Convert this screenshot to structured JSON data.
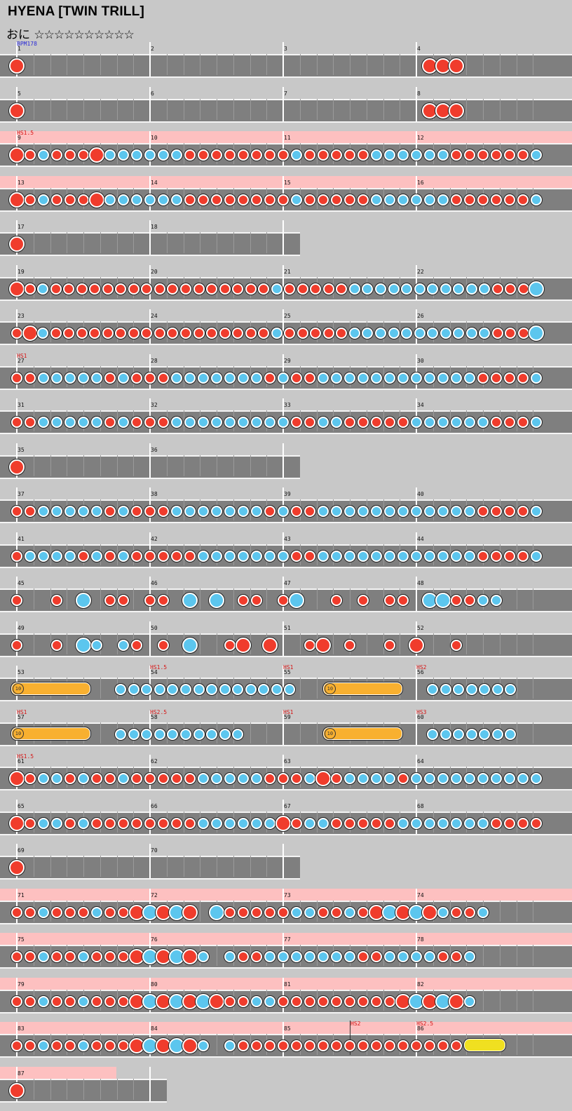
{
  "title": "HYENA [TWIN TRILL]",
  "difficulty": "おに",
  "stars": "☆☆☆☆☆☆☆☆☆☆",
  "colors": {
    "background": "#c8c8c8",
    "track": "#7f7f7f",
    "don": "#f03c2c",
    "ka": "#5cc6ee",
    "scroll_band": "#fdc0c0",
    "roll": "#f8b030",
    "balloon": "#f0e020"
  },
  "rows": [
    {
      "measures": [
        "1",
        "2",
        "3",
        "4"
      ],
      "labels": [
        {
          "text": "BPM178",
          "type": "bpm"
        }
      ],
      "band": false,
      "notes": "D..............................DDD......"
    },
    {
      "measures": [
        "5",
        "6",
        "7",
        "8"
      ],
      "labels": [],
      "band": false,
      "notes": "D..............................DDD......"
    },
    {
      "measures": [
        "9",
        "10",
        "11",
        "12"
      ],
      "labels": [
        {
          "text": "HS1.5",
          "type": "hs"
        }
      ],
      "band": true,
      "notes": "DdkdddDkkkkkkddddddddkdddddkkkkkkddddddk"
    },
    {
      "measures": [
        "13",
        "14",
        "15",
        "16"
      ],
      "labels": [],
      "band": true,
      "notes": "DdkdddDkkkkkkddddddddkdddddkkkkkkddddddk"
    },
    {
      "measures": [
        "17",
        "18"
      ],
      "labels": [],
      "band": false,
      "short": true,
      "notes": "D..................."
    },
    {
      "measures": [
        "19",
        "20",
        "21",
        "22"
      ],
      "labels": [],
      "band": false,
      "notes": "DdkdddddddddddddddddkdddddkkkkkkkkkkkdddK"
    },
    {
      "measures": [
        "23",
        "24",
        "25",
        "26"
      ],
      "labels": [],
      "band": false,
      "notes": "dDkdddddddddddddddddkdddddkkkkkkkkkkkdddK"
    },
    {
      "measures": [
        "27",
        "28",
        "29",
        "30"
      ],
      "labels": [
        {
          "text": "HS1",
          "type": "hs"
        }
      ],
      "band": false,
      "notes": "ddkkkkkdkdddkkkkkkkdkddkkkkkkkkkkkkddddk"
    },
    {
      "measures": [
        "31",
        "32",
        "33",
        "34"
      ],
      "labels": [],
      "band": false,
      "notes": "ddkkkkkdkdddkkkkkkkkkddkkdddddkkkkkkdddk"
    },
    {
      "measures": [
        "35",
        "36"
      ],
      "labels": [],
      "band": false,
      "short": true,
      "notes": "D..................."
    },
    {
      "measures": [
        "37",
        "38",
        "39",
        "40"
      ],
      "labels": [],
      "band": false,
      "notes": "ddkkkkkdkdddkkkkkkkdkddkkkkkkkkkkkkddddk"
    },
    {
      "measures": [
        "41",
        "42",
        "43",
        "44"
      ],
      "labels": [],
      "band": false,
      "notes": "dkkkkdkdkdddddkkkkkkkddkkkkkkkkkkkkddddk"
    },
    {
      "measures": [
        "45",
        "46",
        "47",
        "48"
      ],
      "labels": [],
      "band": false,
      "notes": "d..d.K.dd.dd.K.K.dd.dK..d.d.dd.KKddkk..."
    },
    {
      "measures": [
        "49",
        "50",
        "51",
        "52"
      ],
      "labels": [],
      "band": false,
      "notes": "d..d.Kk.kd.d.K..dD.D..dD.d..d.D..d......"
    },
    {
      "measures": [
        "53",
        "54",
        "55",
        "56"
      ],
      "labels": [
        {
          "text": "HS1.5",
          "type": "hs"
        },
        {
          "text": "HS1",
          "type": "hs"
        },
        {
          "text": "HS2",
          "type": "hs"
        }
      ],
      "band": false,
      "notes": "RRRRRR..kkkkkkkkkkkkkk..RRRRRR..kkkkkkk.."
    },
    {
      "measures": [
        "57",
        "58",
        "59",
        "60"
      ],
      "labels": [
        {
          "text": "HS1",
          "type": "hs"
        },
        {
          "text": "HS2.5",
          "type": "hs"
        },
        {
          "text": "HS1",
          "type": "hs"
        },
        {
          "text": "HS3",
          "type": "hs"
        }
      ],
      "band": false,
      "notes": "RRRRRR..kkkkkkkkkk......RRRRRR..kkkkkkk.."
    },
    {
      "measures": [
        "61",
        "62",
        "63",
        "64"
      ],
      "labels": [
        {
          "text": "HS1.5",
          "type": "hs"
        }
      ],
      "band": false,
      "notes": "DdkkdkddkdddddkkkkkdddkDdkkkkdkkkkkkkkkk"
    },
    {
      "measures": [
        "65",
        "66",
        "67",
        "68"
      ],
      "labels": [],
      "band": false,
      "notes": "DdkkdkddddddddkkkkkkDdkkdddddkkkkkkkdddd"
    },
    {
      "measures": [
        "69",
        "70"
      ],
      "labels": [],
      "band": false,
      "short": true,
      "notes": "D..................."
    },
    {
      "measures": [
        "71",
        "72",
        "73",
        "74"
      ],
      "labels": [],
      "band": true,
      "notes": "ddkdddkddDKDKD.KdddddkkddkdDKDKDkddk...."
    },
    {
      "measures": [
        "75",
        "76",
        "77",
        "78"
      ],
      "labels": [],
      "band": true,
      "notes": "ddkddkdddDKDKDk.kddkkkkkkkddkkkkddk....."
    },
    {
      "measures": [
        "79",
        "80",
        "81",
        "82"
      ],
      "labels": [],
      "band": true,
      "notes": "ddkddkdddDKDKDKDddkkdddddddddDKDKDk....."
    },
    {
      "measures": [
        "83",
        "84",
        "85",
        "86"
      ],
      "labels": [
        {
          "text": "HS2",
          "type": "hs"
        },
        {
          "text": "HS2.5",
          "type": "hs"
        }
      ],
      "band": true,
      "notes": "ddkddkdddDKDKDk.kdddddddddddddddddBBB..."
    },
    {
      "measures": [
        "87"
      ],
      "labels": [],
      "band": true,
      "tiny": true,
      "notes": "D........."
    }
  ]
}
